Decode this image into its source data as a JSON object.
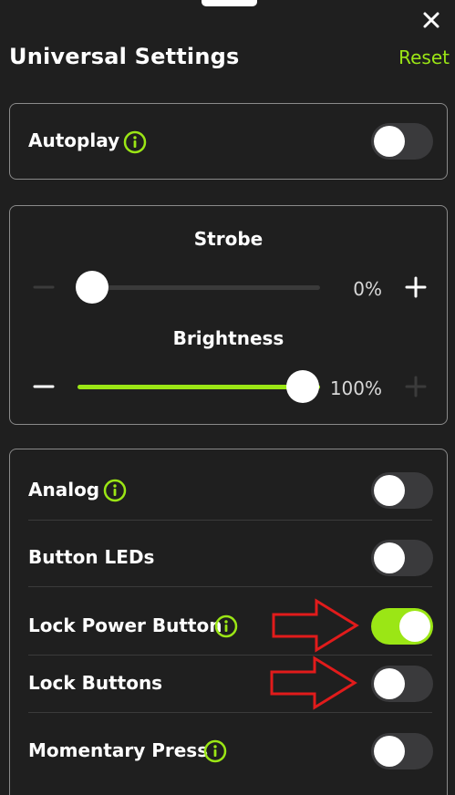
{
  "header": {
    "title": "Universal Settings",
    "reset_label": "Reset",
    "close_icon": "close-icon"
  },
  "colors": {
    "accent": "#9be615",
    "background": "#1f1f1f",
    "annotation_arrow": "#e11b1b"
  },
  "autoplay": {
    "label": "Autoplay",
    "on": false,
    "has_info": true
  },
  "sliders": {
    "strobe": {
      "label": "Strobe",
      "value": 0,
      "value_text": "0%"
    },
    "brightness": {
      "label": "Brightness",
      "value": 100,
      "value_text": "100%"
    }
  },
  "options": [
    {
      "label": "Analog",
      "on": false,
      "has_info": true
    },
    {
      "label": "Button LEDs",
      "on": false,
      "has_info": false
    },
    {
      "label": "Lock Power Button",
      "on": true,
      "has_info": true
    },
    {
      "label": "Lock Buttons",
      "on": false,
      "has_info": false
    },
    {
      "label": "Momentary Press",
      "on": false,
      "has_info": true
    }
  ]
}
